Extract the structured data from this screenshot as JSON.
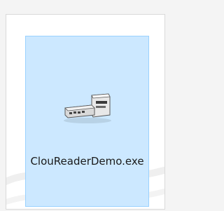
{
  "file": {
    "name": "ClouReaderDemo.exe",
    "icon": "card-reader-device-icon",
    "selected": true
  },
  "colors": {
    "selection_fill": "#cce8ff",
    "selection_border": "#99d1ff",
    "frame_border": "#d9d9d9",
    "text": "#1a1a1a"
  }
}
